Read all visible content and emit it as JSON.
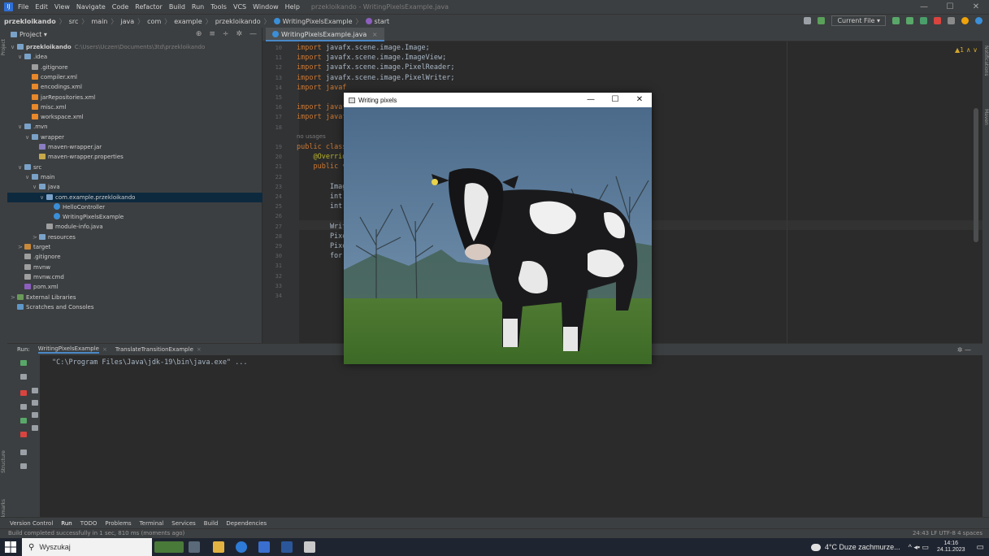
{
  "menu": {
    "items": [
      "File",
      "Edit",
      "View",
      "Navigate",
      "Code",
      "Refactor",
      "Build",
      "Run",
      "Tools",
      "VCS",
      "Window",
      "Help"
    ],
    "window_title": "przekloikando - WritingPixelsExample.java"
  },
  "window_controls": {
    "minimize": "—",
    "maximize": "☐",
    "close": "✕"
  },
  "breadcrumbs": [
    "przekloikando",
    "src",
    "main",
    "java",
    "com",
    "example",
    "przekloikando",
    "WritingPixelsExample",
    "start"
  ],
  "nav_tools": {
    "run_config": "Current File ▾"
  },
  "left_stripe": {
    "project": "Project",
    "structure": "Structure",
    "bookmarks": "Bookmarks"
  },
  "right_stripe": {
    "notifications": "Notifications",
    "maven": "Maven"
  },
  "project": {
    "title": "Project ▾",
    "root_path": "C:\\Users\\Uczen\\Documents\\3td\\przekloikando",
    "tree": [
      {
        "label": "przekloikando",
        "icon": "folder",
        "depth": 0,
        "arrow": "∨"
      },
      {
        "label": ".idea",
        "icon": "folder",
        "depth": 1,
        "arrow": "∨"
      },
      {
        "label": ".gitignore",
        "icon": "git",
        "depth": 2,
        "arrow": ""
      },
      {
        "label": "compiler.xml",
        "icon": "xml",
        "depth": 2,
        "arrow": ""
      },
      {
        "label": "encodings.xml",
        "icon": "xml",
        "depth": 2,
        "arrow": ""
      },
      {
        "label": "jarRepositories.xml",
        "icon": "xml",
        "depth": 2,
        "arrow": ""
      },
      {
        "label": "misc.xml",
        "icon": "xml",
        "depth": 2,
        "arrow": ""
      },
      {
        "label": "workspace.xml",
        "icon": "xml",
        "depth": 2,
        "arrow": ""
      },
      {
        "label": ".mvn",
        "icon": "folder",
        "depth": 1,
        "arrow": "∨"
      },
      {
        "label": "wrapper",
        "icon": "folder",
        "depth": 2,
        "arrow": "∨"
      },
      {
        "label": "maven-wrapper.jar",
        "icon": "jar",
        "depth": 3,
        "arrow": ""
      },
      {
        "label": "maven-wrapper.properties",
        "icon": "prop",
        "depth": 3,
        "arrow": ""
      },
      {
        "label": "src",
        "icon": "folder",
        "depth": 1,
        "arrow": "∨"
      },
      {
        "label": "main",
        "icon": "folder",
        "depth": 2,
        "arrow": "∨"
      },
      {
        "label": "java",
        "icon": "folder",
        "depth": 3,
        "arrow": "∨"
      },
      {
        "label": "com.example.przekloikando",
        "icon": "folder",
        "depth": 4,
        "arrow": "∨",
        "selected": true
      },
      {
        "label": "HelloController",
        "icon": "class",
        "depth": 5,
        "arrow": ""
      },
      {
        "label": "WritingPixelsExample",
        "icon": "class",
        "depth": 5,
        "arrow": ""
      },
      {
        "label": "module-info.java",
        "icon": "git",
        "depth": 4,
        "arrow": ""
      },
      {
        "label": "resources",
        "icon": "folder",
        "depth": 3,
        "arrow": ">"
      },
      {
        "label": "target",
        "icon": "target",
        "depth": 1,
        "arrow": ">"
      },
      {
        "label": ".gitignore",
        "icon": "git",
        "depth": 1,
        "arrow": ""
      },
      {
        "label": "mvnw",
        "icon": "git",
        "depth": 1,
        "arrow": ""
      },
      {
        "label": "mvnw.cmd",
        "icon": "git",
        "depth": 1,
        "arrow": ""
      },
      {
        "label": "pom.xml",
        "icon": "mvn",
        "depth": 1,
        "arrow": ""
      },
      {
        "label": "External Libraries",
        "icon": "lib",
        "depth": 0,
        "arrow": ">"
      },
      {
        "label": "Scratches and Consoles",
        "icon": "scr",
        "depth": 0,
        "arrow": ""
      }
    ]
  },
  "editor": {
    "tab": "WritingPixelsExample.java",
    "inspection": "▲1 ∧ ∨",
    "lines": [
      {
        "n": "10",
        "code": "import javafx.scene.image.Image;"
      },
      {
        "n": "11",
        "code": "import javafx.scene.image.ImageView;"
      },
      {
        "n": "12",
        "code": "import javafx.scene.image.PixelReader;"
      },
      {
        "n": "13",
        "code": "import javafx.scene.image.PixelWriter;"
      },
      {
        "n": "14",
        "code": "import javaf"
      },
      {
        "n": "15",
        "code": ""
      },
      {
        "n": "16",
        "code": "import javaf"
      },
      {
        "n": "17",
        "code": "import javaf"
      },
      {
        "n": "18",
        "code": ""
      },
      {
        "n": "",
        "code": "no usages"
      },
      {
        "n": "19",
        "code": "public class"
      },
      {
        "n": "20",
        "code": "    @Overrid"
      },
      {
        "n": "21",
        "code": "    public v"
      },
      {
        "n": "22",
        "code": ""
      },
      {
        "n": "23",
        "code": "        Imag"
      },
      {
        "n": "24",
        "code": "        int "
      },
      {
        "n": "25",
        "code": "        int "
      },
      {
        "n": "26",
        "code": ""
      },
      {
        "n": "27",
        "code": "        Writ"
      },
      {
        "n": "28",
        "code": "        Pixe"
      },
      {
        "n": "29",
        "code": "        Pixe"
      },
      {
        "n": "30",
        "code": "        for("
      },
      {
        "n": "31",
        "code": ""
      },
      {
        "n": "32",
        "code": ""
      },
      {
        "n": "33",
        "code": ""
      },
      {
        "n": "34",
        "code": ""
      }
    ]
  },
  "run": {
    "label": "Run:",
    "tabs": [
      "WritingPixelsExample",
      "TranslateTransitionExample"
    ],
    "console": "\"C:\\Program Files\\Java\\jdk-19\\bin\\java.exe\" ..."
  },
  "bottom_tools": [
    "Version Control",
    "Run",
    "TODO",
    "Problems",
    "Terminal",
    "Services",
    "Build",
    "Dependencies"
  ],
  "status": {
    "message": "Build completed successfully in 1 sec, 810 ms (moments ago)",
    "right": "24:43  LF  UTF-8  4 spaces"
  },
  "taskbar": {
    "search_placeholder": "Wyszukaj",
    "weather": "4°C  Duze zachmurze...",
    "time": "14:16",
    "date": "24.11.2023"
  },
  "fx_window": {
    "title": "Writing pixels",
    "controls": {
      "minimize": "—",
      "maximize": "☐",
      "close": "✕"
    }
  },
  "colors": {
    "accent": "#4a88c7",
    "background": "#2b2b2b",
    "panel": "#3c3f41",
    "keyword": "#cc7832",
    "selection": "#0d293e"
  }
}
